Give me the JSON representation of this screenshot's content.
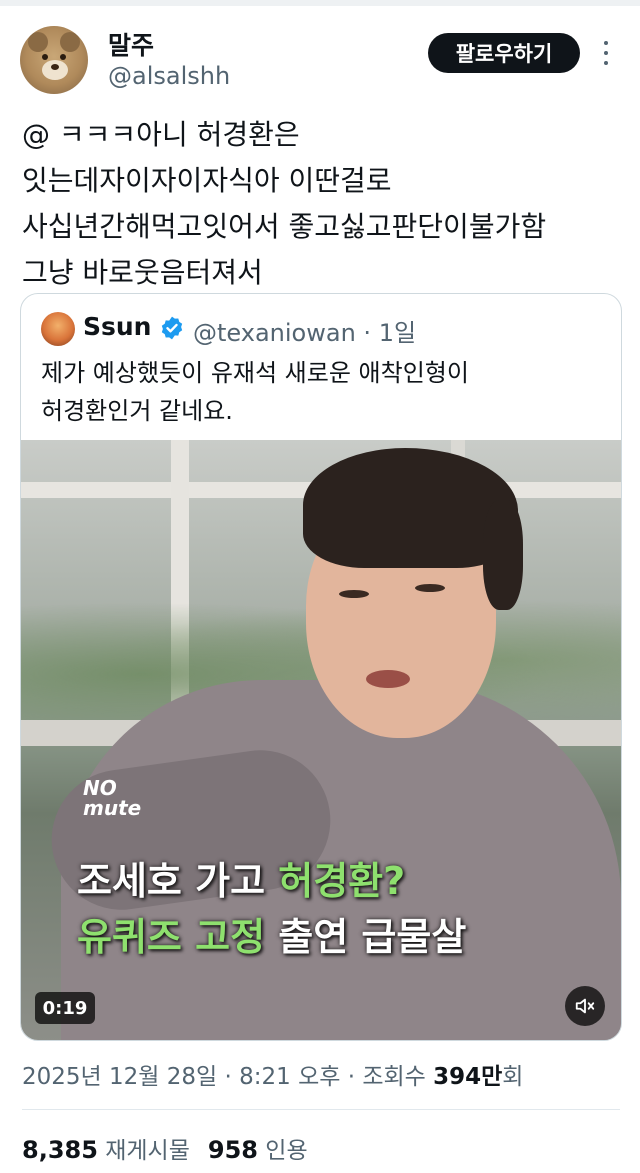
{
  "author": {
    "display_name": "말주",
    "handle": "@alsalshh",
    "avatar_icon": "teddy-bear-avatar"
  },
  "follow_button": "팔로우하기",
  "tweet_lines": [
    "@ ㅋㅋㅋ아니 허경환은",
    "잇는데자이자이자식아 이딴걸로",
    "사십년간해먹고잇어서 좋고싫고판단이불가함",
    "그냥 바로웃음터져서"
  ],
  "quote": {
    "display_name": "Ssun",
    "handle": "@texaniowan",
    "separator": "·",
    "time": "1일",
    "text_lines": [
      "제가 예상했듯이 유재석 새로운 애착인형이",
      "허경환인거 같네요."
    ],
    "video": {
      "watermark_line1": "NO",
      "watermark_line2": "mute",
      "caption_line1_white": "조세호 가고 ",
      "caption_line1_green": "허경환?",
      "caption_line2_green": "유퀴즈 고정",
      "caption_line2_white": " 출연 급물살",
      "duration": "0:19",
      "caption_green_color": "#8ee06e"
    }
  },
  "meta": {
    "date": "2025년 12월 28일",
    "dot1": "·",
    "time": "8:21 오후",
    "dot2": "·",
    "views_label": "조회수",
    "views_value": "394만",
    "views_suffix": "회"
  },
  "stats": {
    "retweets_value": "8,385",
    "retweets_label": "재게시물",
    "quotes_value": "958",
    "quotes_label": "인용"
  },
  "colors": {
    "text": "#0f1419",
    "secondary": "#536471",
    "verified": "#1d9bf0",
    "follow_bg": "#0f1419"
  }
}
